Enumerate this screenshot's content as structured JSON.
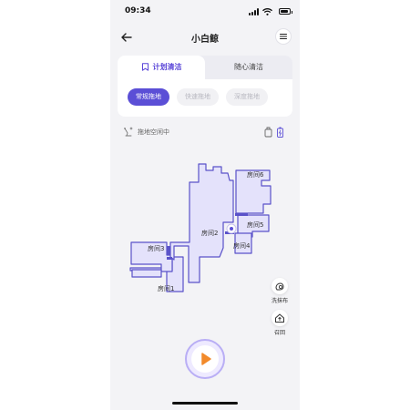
{
  "status_bar": {
    "time": "09:34"
  },
  "nav": {
    "title": "小白鲸"
  },
  "tabs": [
    {
      "label": "计划清洁",
      "active": true
    },
    {
      "label": "随心清洁",
      "active": false
    }
  ],
  "modes": [
    {
      "label": "常规拖地",
      "active": true
    },
    {
      "label": "快速拖地",
      "active": false
    },
    {
      "label": "深度拖地",
      "active": false
    }
  ],
  "status": {
    "text": "拖地空闲中"
  },
  "map": {
    "rooms": [
      "房间6",
      "房间2",
      "房间5",
      "房间4",
      "房间3",
      "房间1"
    ]
  },
  "side_buttons": [
    {
      "label": "洗抹布",
      "icon": "mop-wash-icon"
    },
    {
      "label": "召回",
      "icon": "recall-home-icon"
    }
  ],
  "colors": {
    "accent": "#5b4fd6",
    "map_fill": "#e4e2fb",
    "map_stroke": "#5a52c9",
    "play_icon": "#f28a2b"
  }
}
